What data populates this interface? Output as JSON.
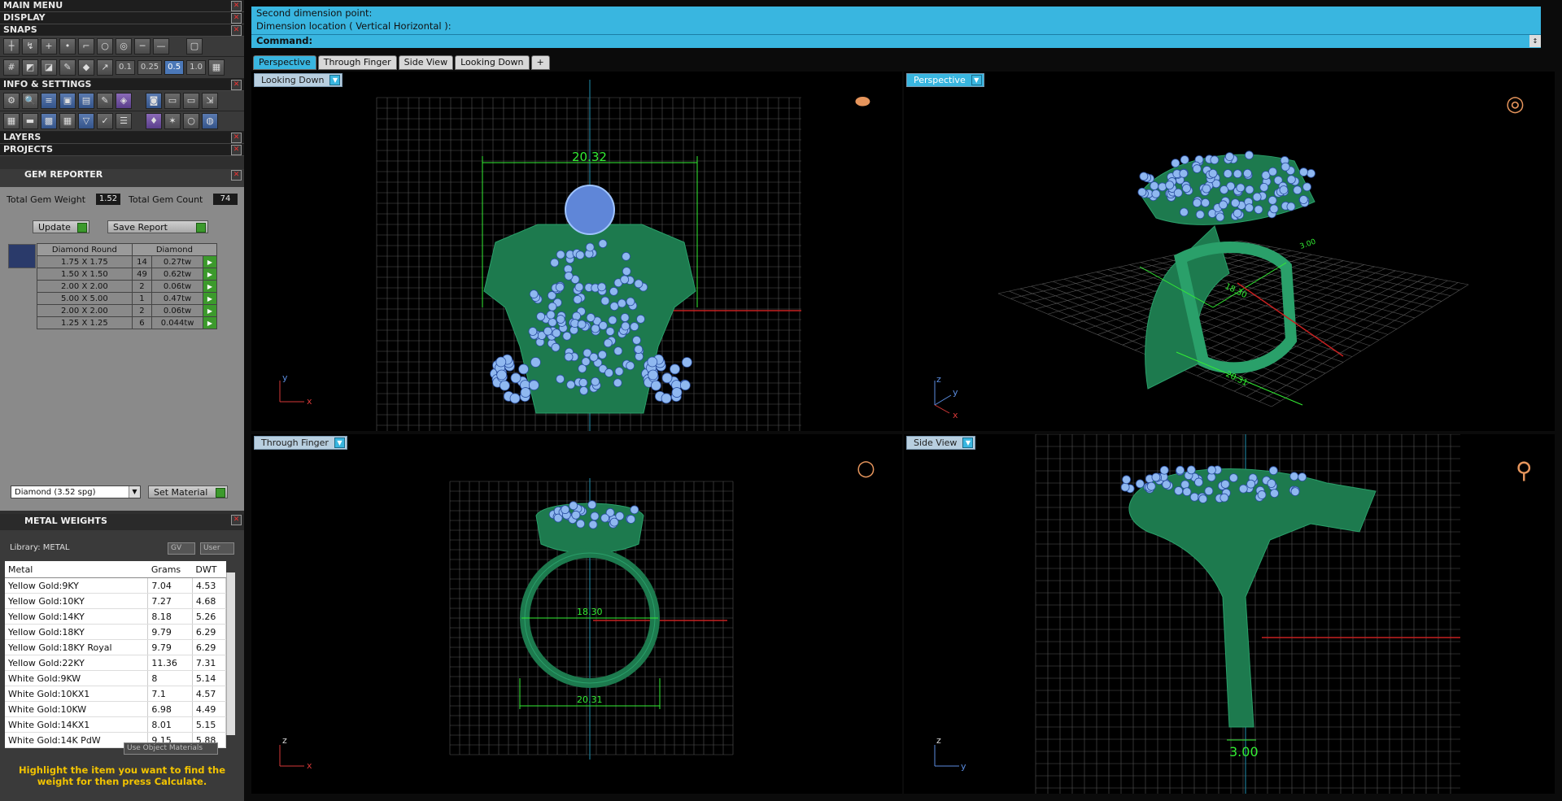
{
  "left_menu": {
    "main_menu": "MAIN MENU",
    "display": "DISPLAY",
    "snaps": "SNAPS",
    "snap_values": [
      "0.1",
      "0.25",
      "0.5",
      "1.0"
    ],
    "info_settings": "INFO & SETTINGS",
    "layers": "LAYERS",
    "projects": "PROJECTS"
  },
  "gem_reporter": {
    "title": "GEM REPORTER",
    "total_weight_label": "Total Gem Weight",
    "total_weight": "1.52",
    "total_count_label": "Total Gem Count",
    "total_count": "74",
    "update_label": "Update",
    "save_label": "Save Report",
    "col_shape": "Diamond Round",
    "col_material": "Diamond",
    "rows": [
      {
        "size": "1.75 X 1.75",
        "count": "14",
        "weight": "0.27tw"
      },
      {
        "size": "1.50 X 1.50",
        "count": "49",
        "weight": "0.62tw"
      },
      {
        "size": "2.00 X 2.00",
        "count": "2",
        "weight": "0.06tw"
      },
      {
        "size": "5.00 X 5.00",
        "count": "1",
        "weight": "0.47tw"
      },
      {
        "size": "2.00 X 2.00",
        "count": "2",
        "weight": "0.06tw"
      },
      {
        "size": "1.25 X 1.25",
        "count": "6",
        "weight": "0.044tw"
      }
    ],
    "material_select": "Diamond    (3.52 spg)",
    "set_material_label": "Set Material"
  },
  "metal_weights": {
    "title": "METAL WEIGHTS",
    "library": "Library: METAL",
    "gv_label": "GV",
    "user_label": "User",
    "columns": [
      "Metal",
      "Grams",
      "DWT"
    ],
    "rows": [
      [
        "Yellow Gold:9KY",
        "7.04",
        "4.53"
      ],
      [
        "Yellow Gold:10KY",
        "7.27",
        "4.68"
      ],
      [
        "Yellow Gold:14KY",
        "8.18",
        "5.26"
      ],
      [
        "Yellow Gold:18KY",
        "9.79",
        "6.29"
      ],
      [
        "Yellow Gold:18KY Royal",
        "9.79",
        "6.29"
      ],
      [
        "Yellow Gold:22KY",
        "11.36",
        "7.31"
      ],
      [
        "White Gold:9KW",
        "8",
        "5.14"
      ],
      [
        "White Gold:10KX1",
        "7.1",
        "4.57"
      ],
      [
        "White Gold:10KW",
        "6.98",
        "4.49"
      ],
      [
        "White Gold:14KX1",
        "8.01",
        "5.15"
      ],
      [
        "White Gold:14K PdW",
        "9.15",
        "5.88"
      ]
    ],
    "use_object_materials": "Use Object Materials",
    "hint": "Highlight the item you want to find the weight for then press Calculate."
  },
  "command": {
    "line1": "Second dimension point:",
    "line2": "Dimension location ( Vertical  Horizontal ):",
    "prompt": "Command:"
  },
  "tabs": [
    "Perspective",
    "Through Finger",
    "Side View",
    "Looking Down",
    "+"
  ],
  "viewports": {
    "top_left": {
      "label": "Looking Down",
      "dim": "20.32",
      "axis_a": "y",
      "axis_b": "x"
    },
    "top_right": {
      "label": "Perspective",
      "dim1": "18.30",
      "dim2": "20.31",
      "dim3": "3.00",
      "axis_a": "z",
      "axis_b": "y",
      "axis_c": "x"
    },
    "bottom_left": {
      "label": "Through Finger",
      "dim1": "18.30",
      "dim2": "20.31",
      "axis_a": "z",
      "axis_b": "x"
    },
    "bottom_right": {
      "label": "Side View",
      "dim": "3.00",
      "axis_a": "z",
      "axis_b": "y"
    }
  },
  "colors": {
    "accent": "#39b6e0",
    "ring": "#1d7a4e",
    "gem": "#8fb8f0",
    "dim": "#33ee33"
  }
}
